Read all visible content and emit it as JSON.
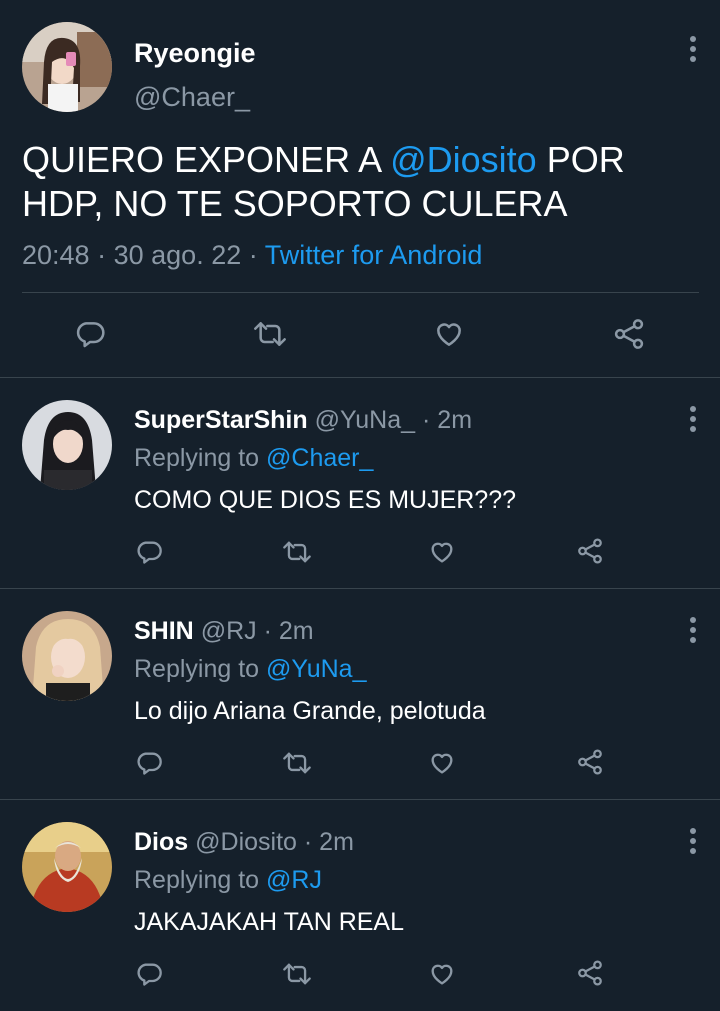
{
  "main_tweet": {
    "name": "Ryeongie",
    "handle": "@Chaer_",
    "text_part1": "QUIERO EXPONER A ",
    "mention": "@Diosito",
    "text_part2": " POR",
    "text_line2": "HDP, NO TE SOPORTO CULERA",
    "time": "20:48",
    "date": "30 ago. 22",
    "sep": "·",
    "source": "Twitter for Android"
  },
  "replies": [
    {
      "name": "SuperStarShin",
      "handle": "@YuNa_",
      "age": "· 2m",
      "replying_label": "Replying to",
      "replying_to": "@Chaer_",
      "text": "COMO QUE DIOS ES MUJER???"
    },
    {
      "name": "SHIN",
      "handle": "@RJ",
      "age": "· 2m",
      "replying_label": "Replying to",
      "replying_to": "@YuNa_",
      "text": "Lo dijo Ariana Grande, pelotuda"
    },
    {
      "name": "Dios",
      "handle": "@Diosito",
      "age": "· 2m",
      "replying_label": "Replying to",
      "replying_to": "@RJ",
      "text": "JAKAJAKAH TAN REAL"
    }
  ],
  "icons": [
    "reply-icon",
    "retweet-icon",
    "like-icon",
    "share-icon",
    "more-icon"
  ],
  "colors": {
    "background": "#15202b",
    "accent": "#1d9bf0",
    "secondary_text": "#8b98a5",
    "divider": "#38444d"
  }
}
